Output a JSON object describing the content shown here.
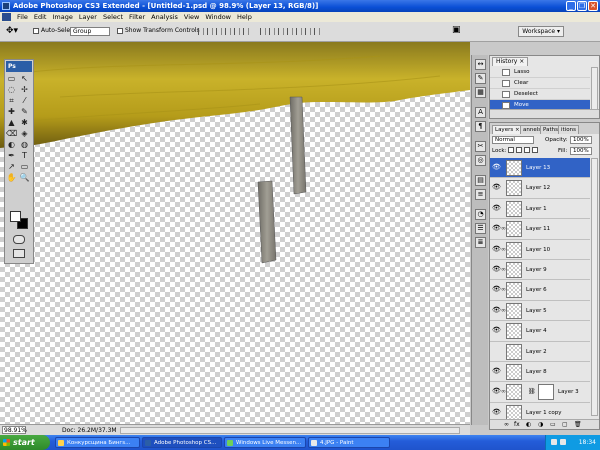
{
  "window": {
    "title": "Adobe Photoshop CS3 Extended - [Untitled-1.psd @ 98.9% (Layer 13, RGB/8)]",
    "controls": [
      "_",
      "❐",
      "✕"
    ]
  },
  "menubar": {
    "items": [
      "File",
      "Edit",
      "Image",
      "Layer",
      "Select",
      "Filter",
      "Analysis",
      "View",
      "Window",
      "Help"
    ]
  },
  "options": {
    "auto_select_label": "Auto-Select:",
    "auto_select_value": "Group",
    "show_transform_label": "Show Transform Controls",
    "workspace_label": "Workspace ▾"
  },
  "tools": {
    "badge": "Ps",
    "icons": [
      "▭",
      "↖",
      "◌",
      "✢",
      "⌗",
      "⁄",
      "✚",
      "✎",
      "▲",
      "✱",
      "⌫",
      "◈",
      "◐",
      "◍",
      "✒",
      "T",
      "↗",
      "▭",
      "✋",
      "🔍"
    ]
  },
  "status": {
    "zoom": "98.91%",
    "doc": "Doc: 26.2M/37.3M"
  },
  "dock_icons": [
    "↔",
    "✎",
    "▦",
    "A",
    "¶",
    "✂",
    "◎",
    "▤",
    "≡",
    "◔",
    "☰",
    "≣"
  ],
  "history": {
    "tab": "History ×",
    "rows": [
      {
        "label": "Lasso",
        "selected": false
      },
      {
        "label": "Clear",
        "selected": false
      },
      {
        "label": "Deselect",
        "selected": false
      },
      {
        "label": "Move",
        "selected": true
      }
    ]
  },
  "layers": {
    "tabs": [
      "Layers ×",
      "annels",
      "Paths",
      "itions"
    ],
    "blend_mode": "Normal",
    "opacity_label": "Opacity:",
    "opacity_value": "100%",
    "lock_label": "Lock:",
    "fill_label": "Fill:",
    "fill_value": "100%",
    "rows": [
      {
        "name": "Layer 13",
        "visible": true,
        "selected": true,
        "linked": false,
        "mask": false
      },
      {
        "name": "Layer 12",
        "visible": true,
        "selected": false,
        "linked": false,
        "mask": false
      },
      {
        "name": "Layer 1",
        "visible": true,
        "selected": false,
        "linked": false,
        "mask": false
      },
      {
        "name": "Layer 11",
        "visible": true,
        "selected": false,
        "linked": true,
        "mask": false
      },
      {
        "name": "Layer 10",
        "visible": true,
        "selected": false,
        "linked": true,
        "mask": false
      },
      {
        "name": "Layer 9",
        "visible": true,
        "selected": false,
        "linked": true,
        "mask": false
      },
      {
        "name": "Layer 6",
        "visible": true,
        "selected": false,
        "linked": true,
        "mask": false
      },
      {
        "name": "Layer 5",
        "visible": true,
        "selected": false,
        "linked": true,
        "mask": false
      },
      {
        "name": "Layer 4",
        "visible": true,
        "selected": false,
        "linked": false,
        "mask": false
      },
      {
        "name": "Layer 2",
        "visible": false,
        "selected": false,
        "linked": false,
        "mask": false
      },
      {
        "name": "Layer 8",
        "visible": true,
        "selected": false,
        "linked": false,
        "mask": false
      },
      {
        "name": "Layer 3",
        "visible": true,
        "selected": false,
        "linked": true,
        "mask": true
      },
      {
        "name": "Layer 1 copy",
        "visible": true,
        "selected": false,
        "linked": false,
        "mask": false
      }
    ],
    "footer_icons": [
      "∞",
      "fx",
      "◐",
      "◑",
      "▭",
      "▢",
      "🗑"
    ]
  },
  "taskbar": {
    "start": "start",
    "tasks": [
      {
        "label": "Конкурсщина Бингs...",
        "active": false
      },
      {
        "label": "Adobe Photoshop CS...",
        "active": true
      },
      {
        "label": "Windows Live Messen...",
        "active": false
      },
      {
        "label": "4.JPG - Paint",
        "active": false
      }
    ],
    "clock": "18:34"
  },
  "colors": {
    "title_blue": "#0a4fd6",
    "selection_blue": "#3163c6",
    "wood_yellow": "#c9a816",
    "plank_gray": "#8e8b82"
  }
}
